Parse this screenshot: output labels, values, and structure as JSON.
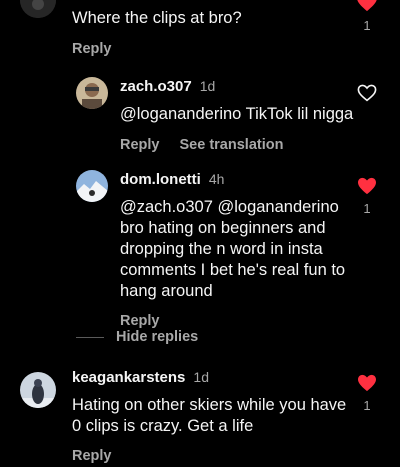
{
  "comments": [
    {
      "id": "c1",
      "text": "Where the clips at bro?",
      "reply_label": "Reply",
      "likes": "1",
      "liked": true
    },
    {
      "id": "c2",
      "username": "zach.o307",
      "time": "1d",
      "text": "@logananderino TikTok lil nigga",
      "reply_label": "Reply",
      "translate_label": "See translation",
      "liked": false
    },
    {
      "id": "c3",
      "username": "dom.lonetti",
      "time": "4h",
      "text": "@zach.o307 @logananderino bro hating on beginners and dropping the n word in insta comments I bet he's real fun to hang around",
      "reply_label": "Reply",
      "likes": "1",
      "liked": true
    },
    {
      "id": "c4",
      "username": "keagankarstens",
      "time": "1d",
      "text": "Hating on other skiers while you have 0 clips is crazy. Get a life",
      "reply_label": "Reply",
      "likes": "1",
      "liked": true
    }
  ],
  "hide_replies_label": "Hide replies",
  "colors": {
    "background": "#000000",
    "text": "#f5f5f5",
    "muted": "#a8a8a8",
    "heart_red": "#ff3040"
  }
}
